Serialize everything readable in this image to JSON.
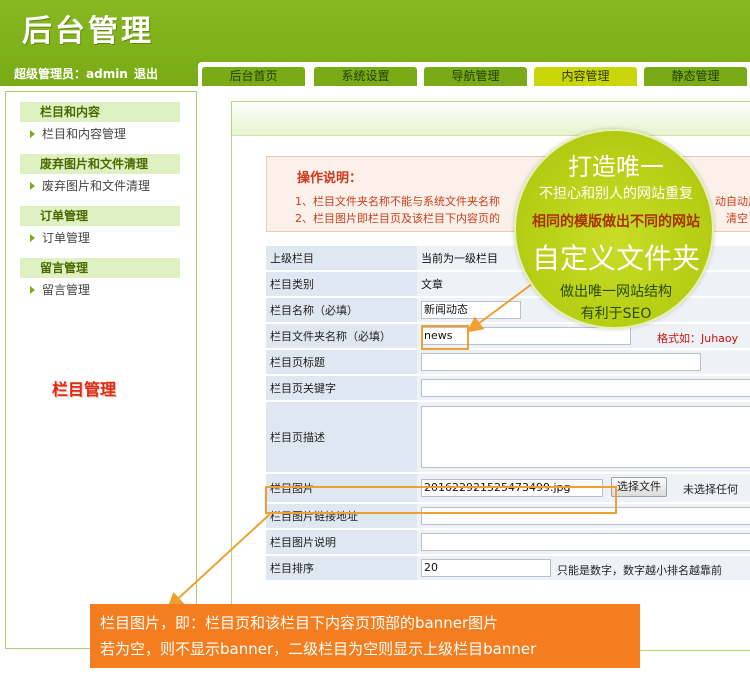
{
  "header": {
    "logo": "后台管理",
    "user_label": "超级管理员：admin",
    "logout_label": "退出"
  },
  "nav": {
    "tabs": [
      "后台首页",
      "系统设置",
      "导航管理",
      "内容管理",
      "静态管理"
    ],
    "active": "内容管理"
  },
  "sidebar": {
    "sections": [
      {
        "title": "栏目和内容",
        "items": [
          "栏目和内容管理"
        ]
      },
      {
        "title": "废弃图片和文件清理",
        "items": [
          "废弃图片和文件清理"
        ]
      },
      {
        "title": "订单管理",
        "items": [
          "订单管理"
        ]
      },
      {
        "title": "留言管理",
        "items": [
          "留言管理"
        ]
      }
    ],
    "page_title": "栏目管理"
  },
  "notice": {
    "title": "操作说明：",
    "line1": "1、栏目文件夹名称不能与系统文件夹名称",
    "line1_tail": "动自动用",
    "line2": "2、栏目图片即栏目页及该栏目下内容页的",
    "line2_tail": "清空"
  },
  "form": {
    "parent": {
      "label": "上级栏目",
      "value": "当前为一级栏目"
    },
    "type": {
      "label": "栏目类别",
      "value": "文章"
    },
    "name": {
      "label": "栏目名称（必填）",
      "value": "新闻动态"
    },
    "folder": {
      "label": "栏目文件夹名称（必填）",
      "value": "news",
      "hint": "格式如：Juhaoy"
    },
    "page_title": {
      "label": "栏目页标题",
      "value": ""
    },
    "keywords": {
      "label": "栏目页关键字",
      "value": ""
    },
    "description": {
      "label": "栏目页描述",
      "value": ""
    },
    "image": {
      "label": "栏目图片",
      "value": "201622921525473499.jpg",
      "button": "选择文件",
      "status": "未选择任何"
    },
    "image_link": {
      "label": "栏目图片链接地址",
      "value": ""
    },
    "image_desc": {
      "label": "栏目图片说明",
      "value": ""
    },
    "sort": {
      "label": "栏目排序",
      "value": "20",
      "hint": "只能是数字，数字越小排名越靠前"
    }
  },
  "bubble": {
    "line1": "打造唯一",
    "line2": "不担心和别人的网站重复",
    "line3": "相同的模版做出不同的网站",
    "line4": "自定义文件夹",
    "line5": "做出唯一网站结构",
    "line6": "有利于SEO"
  },
  "callout": {
    "line1": "栏目图片，即：栏目页和该栏目下内容页顶部的banner图片",
    "line2": "若为空，则不显示banner，二级栏目为空则显示上级栏目banner"
  },
  "colors": {
    "header_green": "#7aab16",
    "active_tab": "#c9d60a",
    "callout_orange": "#f47d1f",
    "highlight": "#f0a030"
  }
}
